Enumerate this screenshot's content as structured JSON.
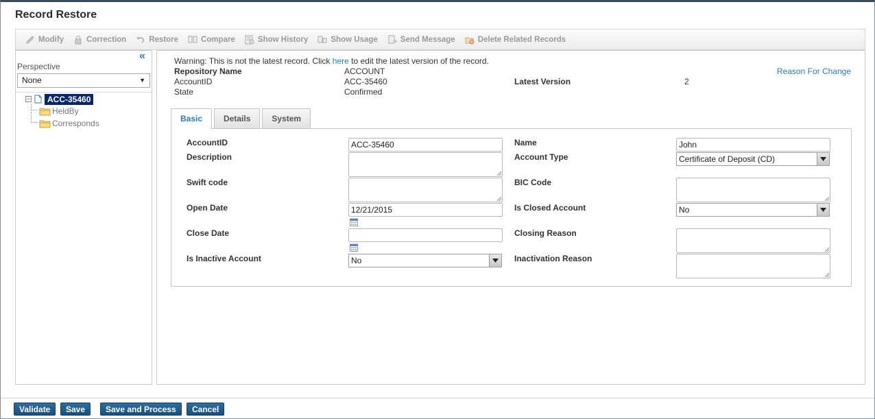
{
  "page": {
    "title": "Record Restore"
  },
  "toolbar": {
    "modify": "Modify",
    "correction": "Correction",
    "restore": "Restore",
    "compare": "Compare",
    "show_history": "Show History",
    "show_usage": "Show Usage",
    "send_message": "Send Message",
    "delete_related": "Delete Related Records"
  },
  "sidebar": {
    "perspective_label": "Perspective",
    "perspective_value": "None",
    "tree": {
      "root": "ACC-35460",
      "children": [
        "HeldBy",
        "Corresponds"
      ]
    }
  },
  "header": {
    "warning_before": "Warning: This is not the latest record. Click ",
    "warning_link": "here",
    "warning_after": " to edit the latest version of the record.",
    "repository_label": "Repository Name",
    "repository_value": "ACCOUNT",
    "accountid_label": "AccountID",
    "accountid_value": "ACC-35460",
    "state_label": "State",
    "state_value": "Confirmed",
    "latest_version_label": "Latest Version",
    "latest_version_value": "2",
    "reason_link": "Reason For Change"
  },
  "tabs": [
    {
      "label": "Basic"
    },
    {
      "label": "Details"
    },
    {
      "label": "System"
    }
  ],
  "form": {
    "accountid_label": "AccountID",
    "accountid_value": "ACC-35460",
    "description_label": "Description",
    "swift_label": "Swift code",
    "open_date_label": "Open Date",
    "open_date_value": "12/21/2015",
    "close_date_label": "Close Date",
    "is_inactive_label": "Is Inactive Account",
    "is_inactive_value": "No",
    "name_label": "Name",
    "name_value": "John",
    "account_type_label": "Account Type",
    "account_type_value": "Certificate of Deposit (CD)",
    "bic_label": "BIC Code",
    "is_closed_label": "Is Closed Account",
    "is_closed_value": "No",
    "closing_reason_label": "Closing Reason",
    "inactivation_reason_label": "Inactivation Reason"
  },
  "footer": {
    "validate": "Validate",
    "save": "Save",
    "save_process": "Save and Process",
    "cancel": "Cancel"
  },
  "colors": {
    "accent": "#2a7ab8",
    "button": "#1c4f78",
    "tree_selected": "#0a246a"
  }
}
